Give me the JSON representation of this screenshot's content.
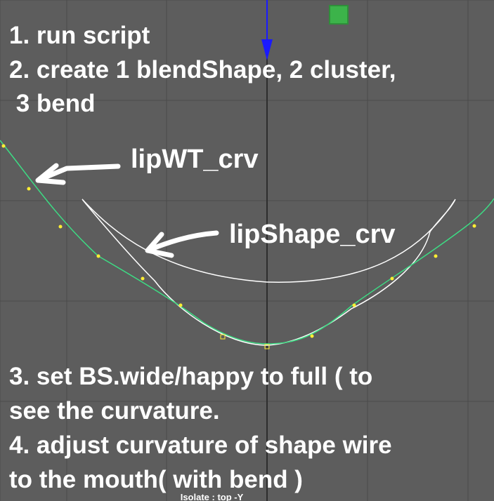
{
  "viewport": {
    "camera_label": "Isolate : top -Y",
    "background_color": "#5d5d5d",
    "grid_color": "#4a4a4a",
    "axis_color": "#2e2e2e",
    "manipulator_axis_color": "#1a1aff",
    "manipulator_square_color": "#3cb34a"
  },
  "curves": {
    "weight_curve": {
      "name": "lipWT_crv",
      "color": "#3ddc84",
      "cv_color": "#ffee33"
    },
    "shape_curve": {
      "name": "lipShape_crv",
      "color": "#ffffff"
    }
  },
  "instructions": {
    "step1": "1. run script",
    "step2_line1": "2. create 1 blendShape, 2 cluster,",
    "step2_line2": " 3 bend",
    "step3_line1": "3. set BS.wide/happy to full ( to",
    "step3_line2": "see the curvature.",
    "step4_line1": "4. adjust curvature of shape wire",
    "step4_line2": "to the mouth( with bend )"
  },
  "annotations": {
    "arrow_icon": "hand-drawn-arrow-icon"
  }
}
